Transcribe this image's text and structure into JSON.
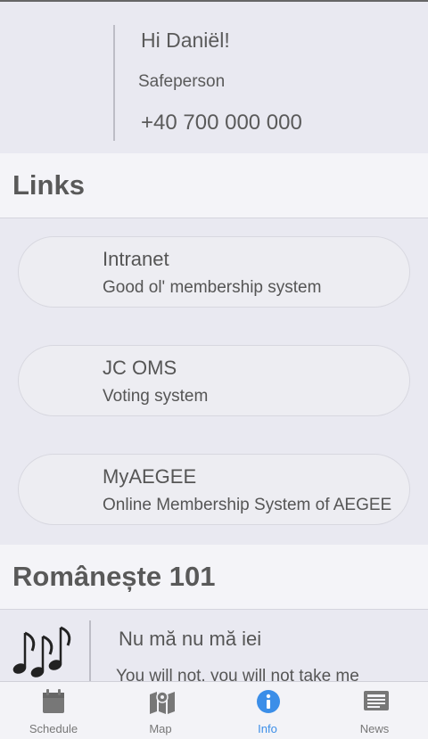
{
  "safeperson": {
    "greeting": "Hi Daniël!",
    "role": "Safeperson",
    "phone": "+40 700 000 000"
  },
  "links": {
    "heading": "Links",
    "items": [
      {
        "title": "Intranet",
        "subtitle": "Good ol' membership system"
      },
      {
        "title": "JC OMS",
        "subtitle": "Voting system"
      },
      {
        "title": "MyAEGEE",
        "subtitle": "Online Membership System of AEGEE"
      }
    ]
  },
  "romanian": {
    "heading": "Românește 101",
    "phrases": [
      {
        "icon": "music-notes-icon",
        "ro": "Nu mă nu mă iei",
        "en": "You will not, you will not take me"
      }
    ]
  },
  "tabbar": {
    "active": "Info",
    "items": [
      {
        "label": "Schedule",
        "icon": "calendar-icon"
      },
      {
        "label": "Map",
        "icon": "map-icon"
      },
      {
        "label": "Info",
        "icon": "info-icon"
      },
      {
        "label": "News",
        "icon": "news-icon"
      }
    ],
    "colors": {
      "active": "#3b8ee8",
      "inactive": "#777777"
    }
  }
}
